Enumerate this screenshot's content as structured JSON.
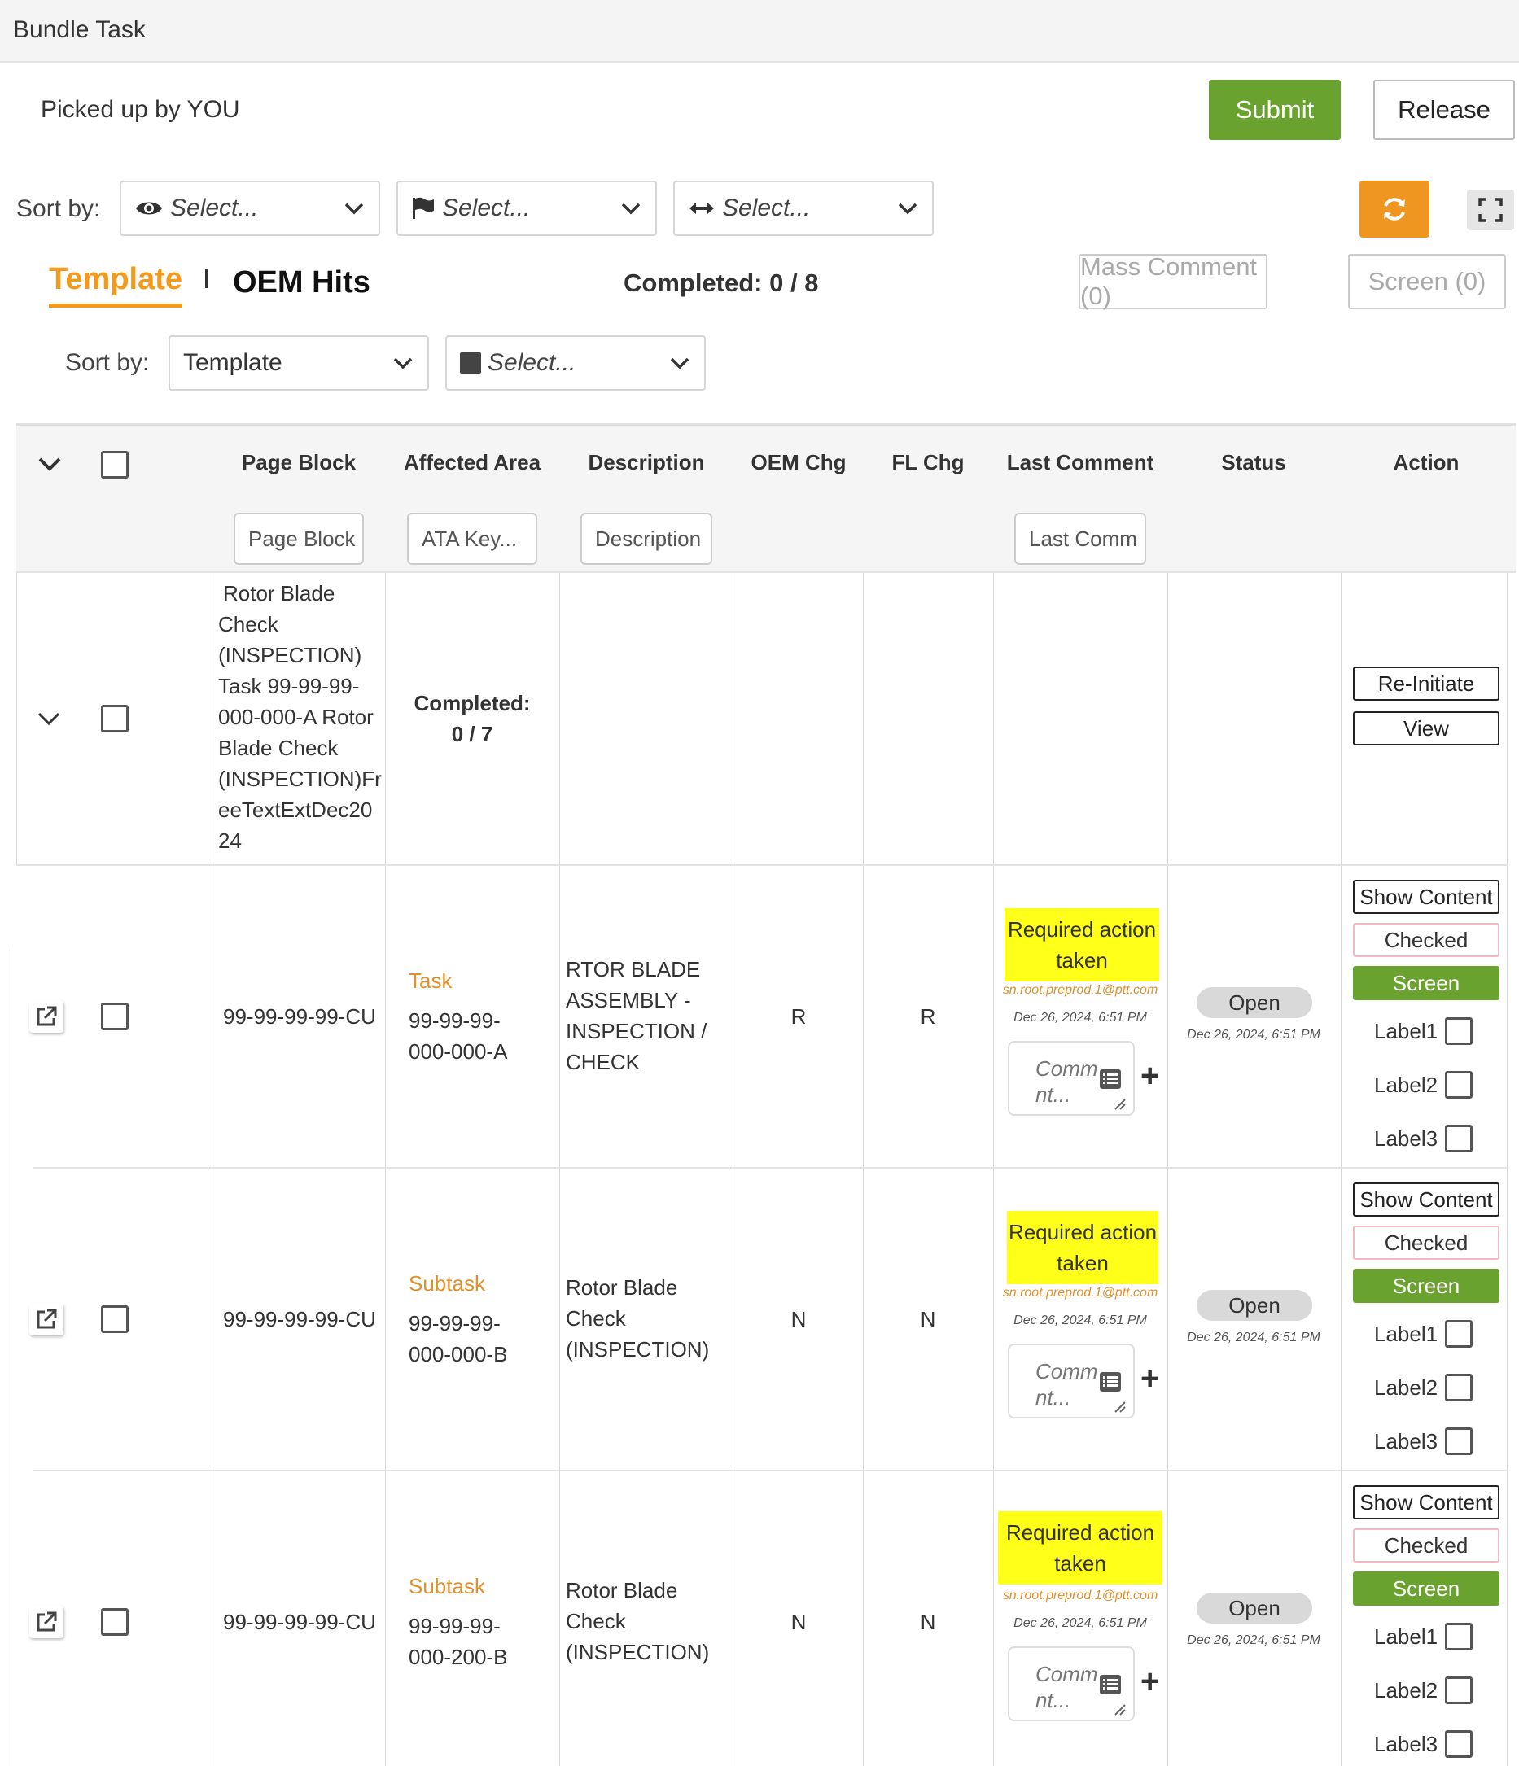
{
  "window": {
    "title": "Bundle Task"
  },
  "header": {
    "picked_up": "Picked up by YOU",
    "submit_label": "Submit",
    "release_label": "Release"
  },
  "sort_top": {
    "label": "Sort by:",
    "selects": [
      {
        "icon": "eye-icon",
        "placeholder": "Select..."
      },
      {
        "icon": "flag-icon",
        "placeholder": "Select..."
      },
      {
        "icon": "horizontal-arrows-icon",
        "placeholder": "Select..."
      }
    ]
  },
  "tabs": {
    "template": "Template",
    "oem_hits": "OEM Hits"
  },
  "summary": {
    "completed": "Completed: 0 / 8"
  },
  "toolbar": {
    "mass_comment": "Mass Comment (0)",
    "screen": "Screen (0)"
  },
  "sort_bottom": {
    "label": "Sort by:",
    "value": "Template",
    "placeholder": "Select..."
  },
  "columns": [
    "Page Block",
    "Affected Area",
    "Description",
    "OEM Chg",
    "FL Chg",
    "Last Comment",
    "Status",
    "Action"
  ],
  "filters": {
    "page_block": "Page Block",
    "ata_key": "ATA Key...",
    "description": "Description",
    "last_comment": "Last Comm"
  },
  "group_row": {
    "page_block_lines": [
      "Rotor Blade",
      "Check",
      "(INSPECTION)",
      "Task 99-99-99-",
      "000-000-A Rotor",
      "Blade Check",
      "(INSPECTION)Fr",
      "eeTextExtDec20",
      "24"
    ],
    "completed_line1": "Completed:",
    "completed_line2": "0 / 7",
    "reinitiate": "Re-Initiate",
    "view": "View"
  },
  "rows": [
    {
      "page_block": "99-99-99-99-CU",
      "type": "Task",
      "ata_line1": "99-99-99-",
      "ata_line2": "000-000-A",
      "desc_lines": [
        "RTOR BLADE",
        "ASSEMBLY -",
        "INSPECTION /",
        "CHECK"
      ],
      "oem_chg": "R",
      "fl_chg": "R",
      "comment_line1": "Required action",
      "comment_line2": "taken",
      "comment_email": "sn.root.preprod.1@ptt.com",
      "comment_date": "Dec 26, 2024, 6:51 PM",
      "comment_ph1": "Comm",
      "comment_ph2": "nt...",
      "status": "Open",
      "status_date": "Dec 26, 2024, 6:51 PM",
      "show_content": "Show Content",
      "checked": "Checked",
      "screen": "Screen",
      "label1": "Label1",
      "label2": "Label2",
      "label3": "Label3"
    },
    {
      "page_block": "99-99-99-99-CU",
      "type": "Subtask",
      "ata_line1": "99-99-99-",
      "ata_line2": "000-000-B",
      "desc_lines": [
        "Rotor Blade",
        "Check",
        "(INSPECTION)"
      ],
      "oem_chg": "N",
      "fl_chg": "N",
      "comment_line1": "Required action",
      "comment_line2": "taken",
      "comment_email": "sn.root.preprod.1@ptt.com",
      "comment_date": "Dec 26, 2024, 6:51 PM",
      "comment_ph1": "Comm",
      "comment_ph2": "nt...",
      "status": "Open",
      "status_date": "Dec 26, 2024, 6:51 PM",
      "show_content": "Show Content",
      "checked": "Checked",
      "screen": "Screen",
      "label1": "Label1",
      "label2": "Label2",
      "label3": "Label3"
    },
    {
      "page_block": "99-99-99-99-CU",
      "type": "Subtask",
      "ata_line1": "99-99-99-",
      "ata_line2": "000-200-B",
      "desc_lines": [
        "Rotor Blade",
        "Check",
        "(INSPECTION)"
      ],
      "oem_chg": "N",
      "fl_chg": "N",
      "comment_line1": "Required action",
      "comment_line2": "taken",
      "comment_email": "sn.root.preprod.1@ptt.com",
      "comment_date": "Dec 26, 2024, 6:51 PM",
      "comment_ph1": "Comm",
      "comment_ph2": "nt...",
      "status": "Open",
      "status_date": "Dec 26, 2024, 6:51 PM",
      "show_content": "Show Content",
      "checked": "Checked",
      "screen": "Screen",
      "label1": "Label1",
      "label2": "Label2",
      "label3": "Label3"
    }
  ],
  "colors": {
    "accent_orange": "#f39a1b",
    "green": "#6aa230",
    "highlight_yellow": "#ffff1a"
  }
}
